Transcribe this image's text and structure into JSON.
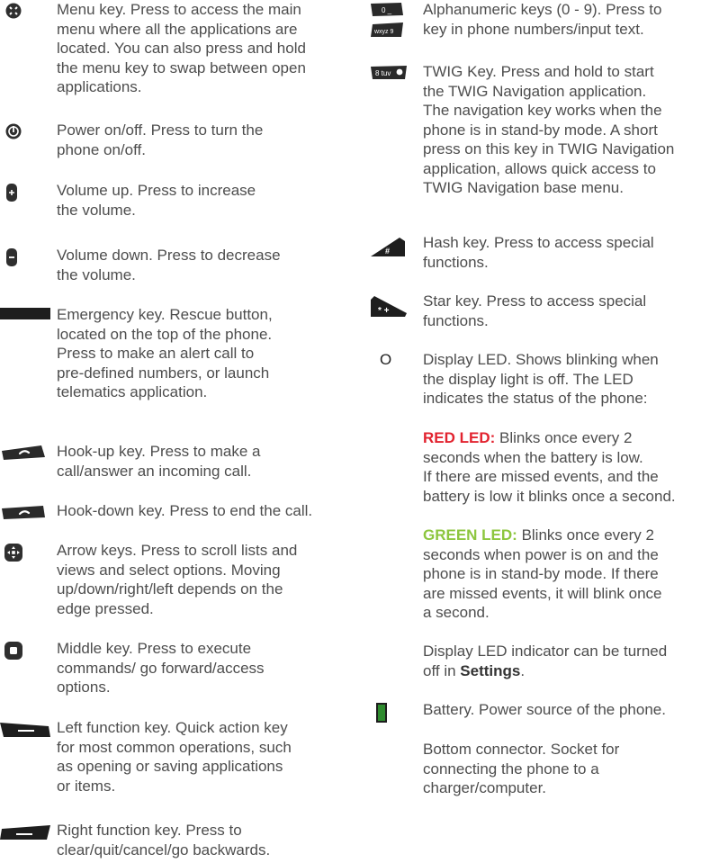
{
  "left": [
    {
      "icon": "menu-key-icon",
      "text": "Menu key. Press to access the main\nmenu where all the applications are\nlocated. You can also press and hold\nthe menu key to swap between open\napplications."
    },
    {
      "icon": "power-icon",
      "text": "Power on/off. Press to turn the\nphone on/off."
    },
    {
      "icon": "volume-up-icon",
      "text": "Volume up. Press to increase\nthe volume."
    },
    {
      "icon": "volume-down-icon",
      "text": "Volume down. Press to decrease\nthe volume."
    },
    {
      "icon": "emergency-key-icon",
      "text": "Emergency key. Rescue button,\nlocated on the top of the phone.\nPress to make an alert call to\npre-defined numbers, or launch\ntelematics application."
    },
    {
      "icon": "hook-up-key-icon",
      "text": "Hook-up key. Press to make a\ncall/answer an incoming call."
    },
    {
      "icon": "hook-down-key-icon",
      "text": "Hook-down key. Press to end the call."
    },
    {
      "icon": "arrow-keys-icon",
      "text": "Arrow keys. Press to scroll lists and\nviews and select options. Moving\nup/down/right/left depends on the\nedge pressed."
    },
    {
      "icon": "middle-key-icon",
      "text": "Middle key. Press to execute\ncommands/ go forward/access\noptions."
    },
    {
      "icon": "left-function-key-icon",
      "text": "Left function key. Quick action key\nfor most common operations, such\nas opening or saving applications\nor items."
    },
    {
      "icon": "right-function-key-icon",
      "text": "Right function key. Press to\nclear/quit/cancel/go backwards."
    }
  ],
  "right": [
    {
      "icon": "alphanumeric-keys-icon",
      "text": "Alphanumeric keys (0 - 9). Press to\nkey in phone numbers/input text.",
      "key_labels": [
        "0 _",
        "wxyz 9"
      ]
    },
    {
      "icon": "twig-key-icon",
      "text": "TWIG Key. Press and hold to start\nthe TWIG Navigation application.\nThe navigation key works when the\nphone is in stand-by mode. A short\npress on this key in TWIG Navigation\napplication, allows quick access to\nTWIG Navigation base menu.",
      "key_label": "8 tuv"
    },
    {
      "icon": "hash-key-icon",
      "text": "Hash key. Press to access special\nfunctions.",
      "key_label": "#"
    },
    {
      "icon": "star-key-icon",
      "text": "Star key. Press to access special\nfunctions.",
      "key_label": "* +"
    },
    {
      "icon": "display-led-icon",
      "text": "Display LED. Shows blinking when\nthe display light is off. The LED\nindicates the status of the phone:",
      "glyph": "O"
    }
  ],
  "red_led": {
    "label": "RED LED:",
    "text": " Blinks once every 2\nseconds when the battery is low.\nIf there are missed events, and the\nbattery is low it blinks once a second."
  },
  "green_led": {
    "label": "GREEN LED:",
    "text": " Blinks once every 2\nseconds when power is on and the\nphone is in stand-by mode. If there\nare missed events, it will blink once\na second."
  },
  "led_settings": {
    "prefix": "Display LED indicator can be turned\noff in ",
    "bold": "Settings",
    "suffix": "."
  },
  "battery": {
    "icon": "battery-icon",
    "text": "Battery. Power source of the phone."
  },
  "bottom_connector": {
    "text": "Bottom connector. Socket for\nconnecting the phone to a\ncharger/computer."
  },
  "colors": {
    "text": "#4d4d4d",
    "red_led": "#e2232f",
    "green_led": "#8dc63f",
    "battery": "#2e8b2e",
    "icon_dark": "#2f2f2f"
  }
}
